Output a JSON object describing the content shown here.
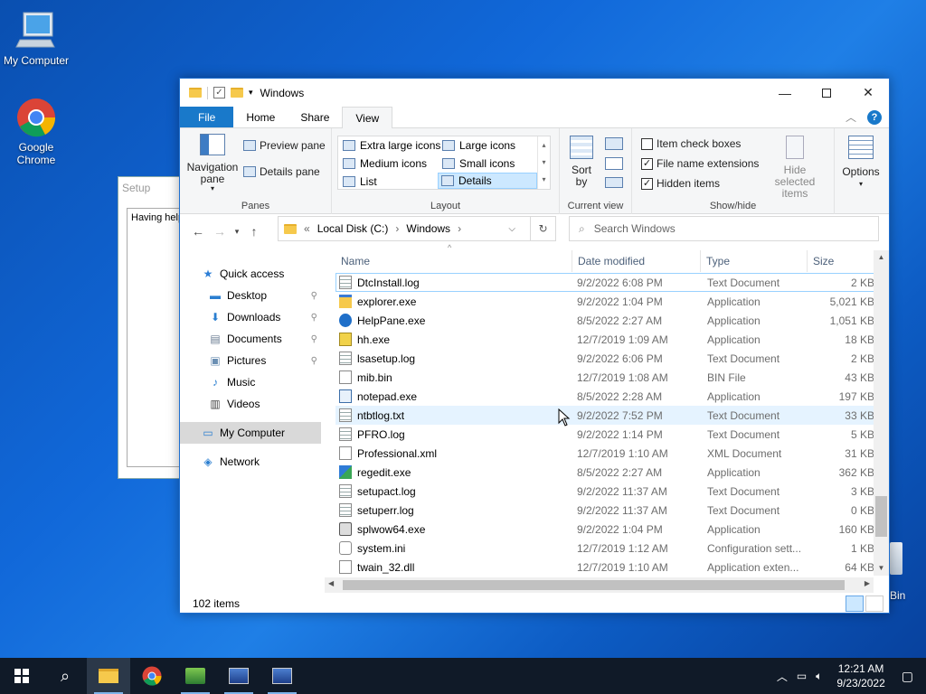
{
  "desktop": {
    "icons": [
      {
        "label": "My Computer"
      },
      {
        "label": "Google Chrome"
      }
    ],
    "recycle_bin_label_fragment": "Bin"
  },
  "setup_window": {
    "title": "Setup",
    "text": "Having help"
  },
  "explorer": {
    "title": "Windows",
    "tabs": [
      "File",
      "Home",
      "Share",
      "View"
    ],
    "active_tab": "View",
    "ribbon": {
      "panes": {
        "label": "Panes",
        "navigation_pane": "Navigation pane",
        "preview_pane": "Preview pane",
        "details_pane": "Details pane"
      },
      "layout": {
        "label": "Layout",
        "items": [
          "Extra large icons",
          "Large icons",
          "Medium icons",
          "Small icons",
          "List",
          "Details"
        ],
        "selected": "Details"
      },
      "current_view": {
        "label": "Current view",
        "sort_by": "Sort by"
      },
      "show_hide": {
        "label": "Show/hide",
        "item_check_boxes": {
          "label": "Item check boxes",
          "checked": false
        },
        "file_name_extensions": {
          "label": "File name extensions",
          "checked": true
        },
        "hidden_items": {
          "label": "Hidden items",
          "checked": true
        },
        "hide_selected_items": "Hide selected items"
      },
      "options": "Options"
    },
    "address": {
      "crumbs": [
        "Local Disk (C:)",
        "Windows"
      ]
    },
    "search_placeholder": "Search Windows",
    "nav": [
      {
        "label": "Quick access",
        "icon": "star-icon",
        "indent": 0,
        "pinned": false
      },
      {
        "label": "Desktop",
        "icon": "desktop-folder-icon",
        "indent": 1,
        "pinned": true
      },
      {
        "label": "Downloads",
        "icon": "download-icon",
        "indent": 1,
        "pinned": true
      },
      {
        "label": "Documents",
        "icon": "documents-icon",
        "indent": 1,
        "pinned": true
      },
      {
        "label": "Pictures",
        "icon": "pictures-icon",
        "indent": 1,
        "pinned": true
      },
      {
        "label": "Music",
        "icon": "music-icon",
        "indent": 1,
        "pinned": false
      },
      {
        "label": "Videos",
        "icon": "videos-icon",
        "indent": 1,
        "pinned": false
      },
      {
        "label": "My Computer",
        "icon": "computer-icon",
        "indent": 0,
        "pinned": false,
        "selected": true
      },
      {
        "label": "Network",
        "icon": "network-icon",
        "indent": 0,
        "pinned": false
      }
    ],
    "columns": [
      "Name",
      "Date modified",
      "Type",
      "Size"
    ],
    "files": [
      {
        "name": "DtcInstall.log",
        "date": "9/2/2022 6:08 PM",
        "type": "Text Document",
        "size": "2 KB",
        "icon": "text-file-icon"
      },
      {
        "name": "explorer.exe",
        "date": "9/2/2022 1:04 PM",
        "type": "Application",
        "size": "5,021 KB",
        "icon": "explorer-app-icon"
      },
      {
        "name": "HelpPane.exe",
        "date": "8/5/2022 2:27 AM",
        "type": "Application",
        "size": "1,051 KB",
        "icon": "help-app-icon"
      },
      {
        "name": "hh.exe",
        "date": "12/7/2019 1:09 AM",
        "type": "Application",
        "size": "18 KB",
        "icon": "help-book-icon"
      },
      {
        "name": "lsasetup.log",
        "date": "9/2/2022 6:06 PM",
        "type": "Text Document",
        "size": "2 KB",
        "icon": "text-file-icon"
      },
      {
        "name": "mib.bin",
        "date": "12/7/2019 1:08 AM",
        "type": "BIN File",
        "size": "43 KB",
        "icon": "blank-file-icon"
      },
      {
        "name": "notepad.exe",
        "date": "8/5/2022 2:28 AM",
        "type": "Application",
        "size": "197 KB",
        "icon": "notepad-icon"
      },
      {
        "name": "ntbtlog.txt",
        "date": "9/2/2022 7:52 PM",
        "type": "Text Document",
        "size": "33 KB",
        "icon": "text-file-icon",
        "hover": true
      },
      {
        "name": "PFRO.log",
        "date": "9/2/2022 1:14 PM",
        "type": "Text Document",
        "size": "5 KB",
        "icon": "text-file-icon"
      },
      {
        "name": "Professional.xml",
        "date": "12/7/2019 1:10 AM",
        "type": "XML Document",
        "size": "31 KB",
        "icon": "blank-file-icon"
      },
      {
        "name": "regedit.exe",
        "date": "8/5/2022 2:27 AM",
        "type": "Application",
        "size": "362 KB",
        "icon": "regedit-icon"
      },
      {
        "name": "setupact.log",
        "date": "9/2/2022 11:37 AM",
        "type": "Text Document",
        "size": "3 KB",
        "icon": "text-file-icon"
      },
      {
        "name": "setuperr.log",
        "date": "9/2/2022 11:37 AM",
        "type": "Text Document",
        "size": "0 KB",
        "icon": "text-file-icon"
      },
      {
        "name": "splwow64.exe",
        "date": "9/2/2022 1:04 PM",
        "type": "Application",
        "size": "160 KB",
        "icon": "printer-icon"
      },
      {
        "name": "system.ini",
        "date": "12/7/2019 1:12 AM",
        "type": "Configuration sett...",
        "size": "1 KB",
        "icon": "config-file-icon"
      },
      {
        "name": "twain_32.dll",
        "date": "12/7/2019 1:10 AM",
        "type": "Application exten...",
        "size": "64 KB",
        "icon": "dll-file-icon"
      }
    ],
    "status": "102 items"
  },
  "taskbar": {
    "time": "12:21 AM",
    "date": "9/23/2022"
  },
  "colors": {
    "accent": "#1979ca",
    "selection": "#cce8ff",
    "taskbar": "#101a28"
  }
}
